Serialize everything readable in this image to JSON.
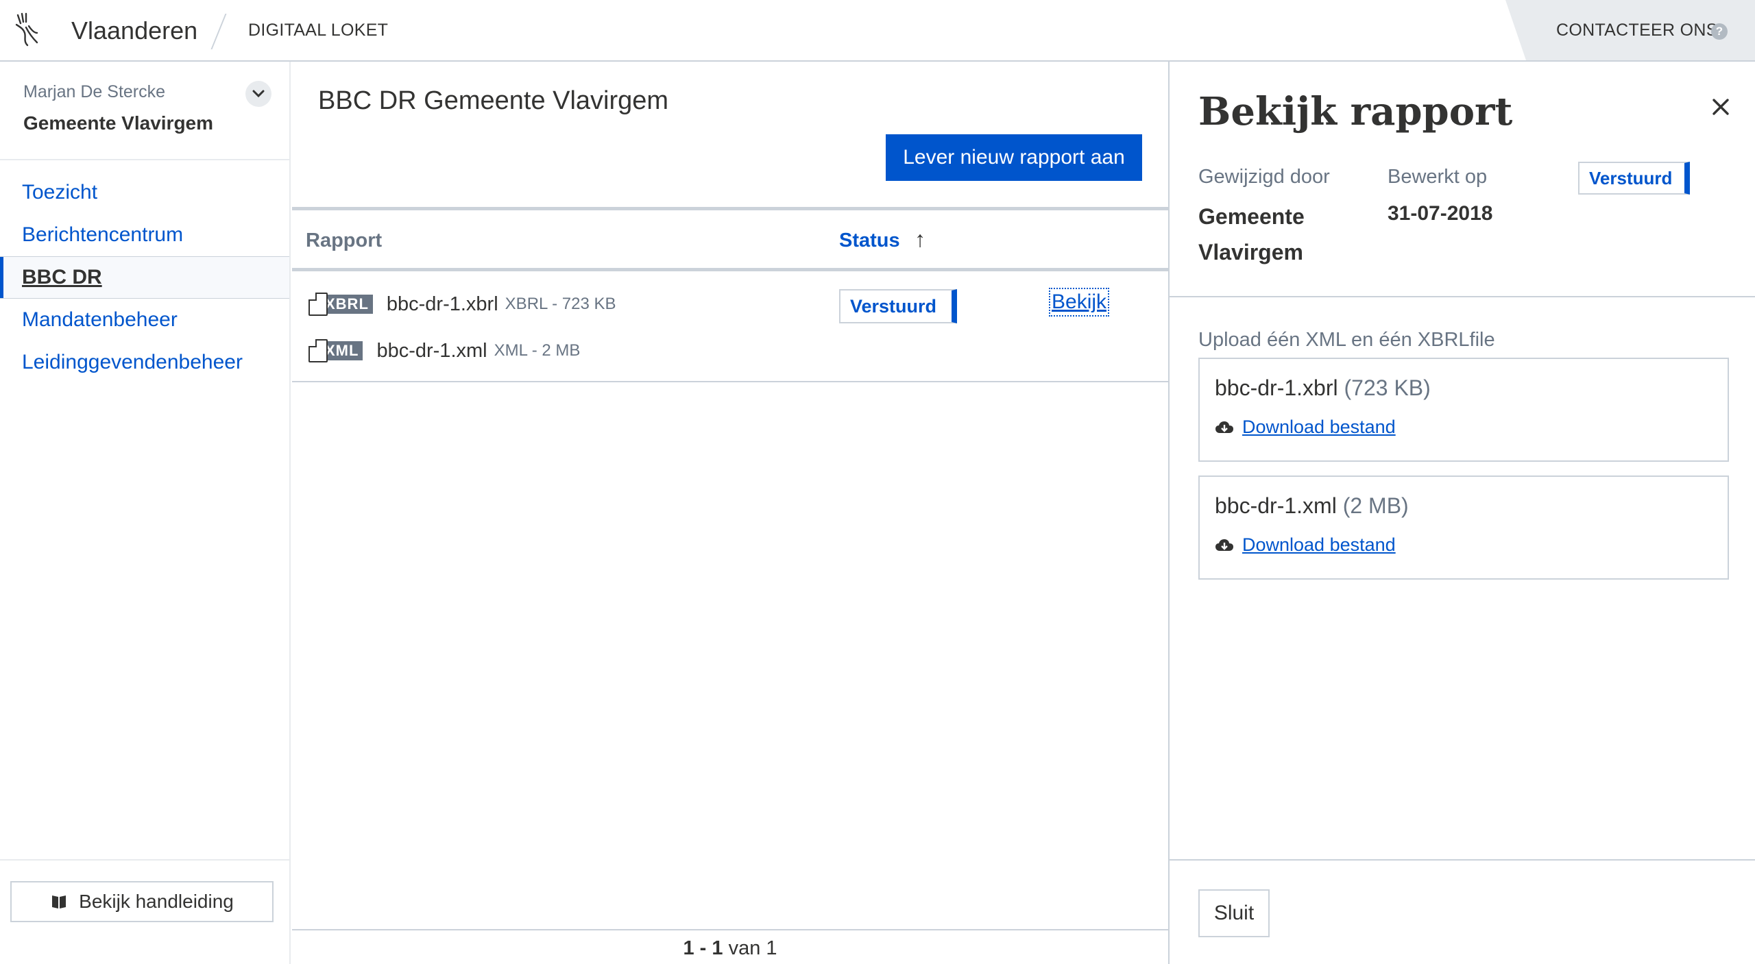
{
  "header": {
    "brand": "Vlaanderen",
    "app_name": "DIGITAAL LOKET",
    "contact_label": "CONTACTEER ONS",
    "help_symbol": "?"
  },
  "sidebar": {
    "user_name": "Marjan De Stercke",
    "organisation": "Gemeente Vlavirgem",
    "items": [
      {
        "label": "Toezicht",
        "active": false
      },
      {
        "label": "Berichtencentrum",
        "active": false
      },
      {
        "label": "BBC DR",
        "active": true
      },
      {
        "label": "Mandatenbeheer",
        "active": false
      },
      {
        "label": "Leidinggevendenbeheer",
        "active": false
      }
    ],
    "manual_button": "Bekijk handleiding"
  },
  "main": {
    "title": "BBC DR Gemeente Vlavirgem",
    "new_report_button": "Lever nieuw rapport aan",
    "table": {
      "headers": {
        "rapport": "Rapport",
        "status": "Status"
      },
      "rows": [
        {
          "files": [
            {
              "badge": "XBRL",
              "name": "bbc-dr-1.xbrl",
              "meta": "XBRL - 723 KB"
            },
            {
              "badge": "XML",
              "name": "bbc-dr-1.xml",
              "meta": "XML - 2 MB"
            }
          ],
          "status": "Verstuurd",
          "action": "Bekijk"
        }
      ]
    },
    "pager": {
      "range": "1 - 1",
      "of_text": "van 1"
    }
  },
  "panel": {
    "title": "Bekijk rapport",
    "modified_by_label": "Gewijzigd door",
    "modified_by_line1": "Gemeente",
    "modified_by_line2": "Vlavirgem",
    "edited_on_label": "Bewerkt op",
    "edited_on_value": "31-07-2018",
    "status": "Verstuurd",
    "upload_label": "Upload één XML en één XBRLfile",
    "files": [
      {
        "name": "bbc-dr-1.xbrl",
        "size": "(723 KB)",
        "download_label": "Download bestand"
      },
      {
        "name": "bbc-dr-1.xml",
        "size": "(2 MB)",
        "download_label": "Download bestand"
      }
    ],
    "close_button": "Sluit"
  },
  "colors": {
    "accent": "#0055cc",
    "text": "#333332",
    "muted": "#687483",
    "border": "#cbd2da"
  }
}
